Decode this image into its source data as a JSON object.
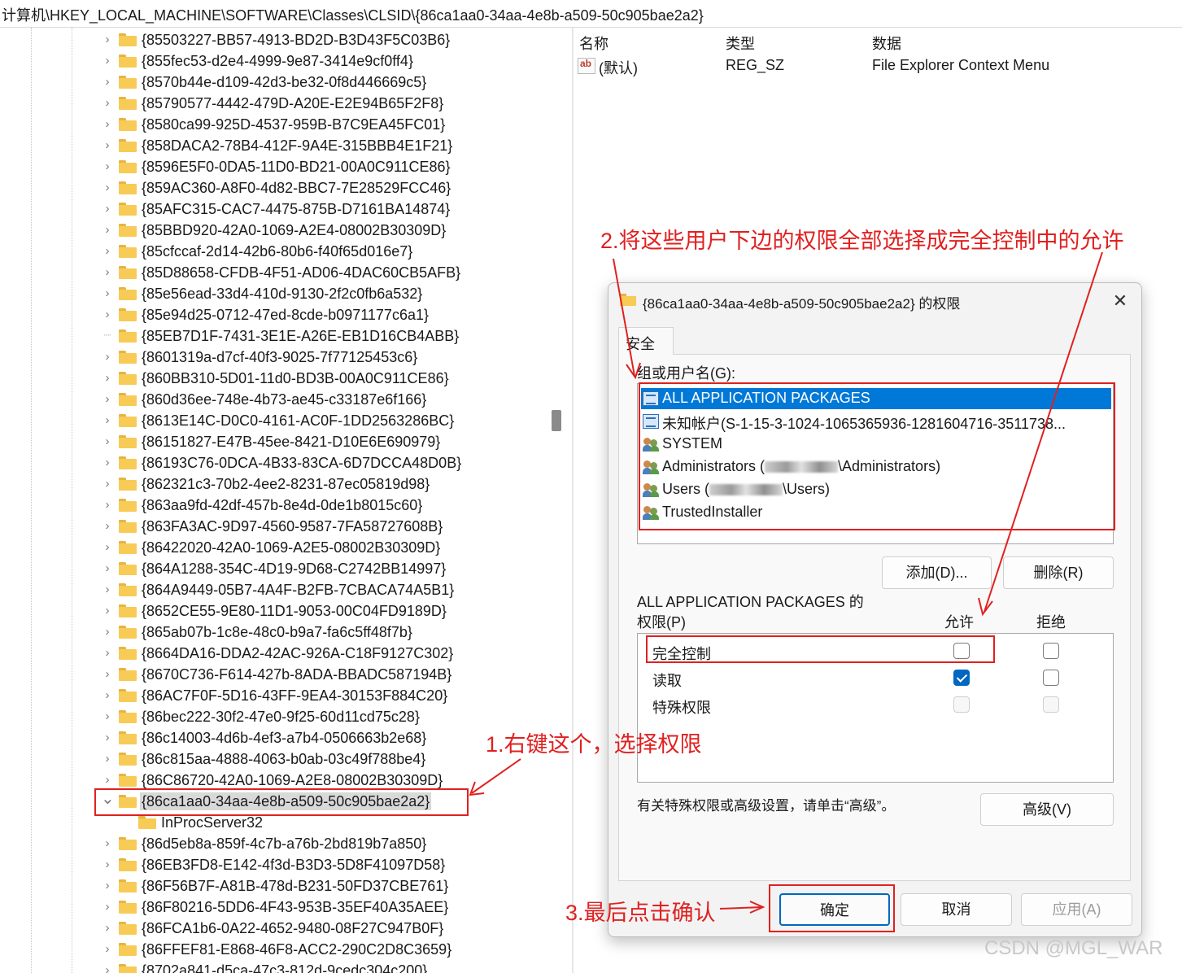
{
  "address_bar": "计算机\\HKEY_LOCAL_MACHINE\\SOFTWARE\\Classes\\CLSID\\{86ca1aa0-34aa-4e8b-a509-50c905bae2a2}",
  "tree": {
    "items": [
      "{85503227-BB57-4913-BD2D-B3D43F5C03B6}",
      "{855fec53-d2e4-4999-9e87-3414e9cf0ff4}",
      "{8570b44e-d109-42d3-be32-0f8d446669c5}",
      "{85790577-4442-479D-A20E-E2E94B65F2F8}",
      "{8580ca99-925D-4537-959B-B7C9EA45FC01}",
      "{858DACA2-78B4-412F-9A4E-315BBB4E1F21}",
      "{8596E5F0-0DA5-11D0-BD21-00A0C911CE86}",
      "{859AC360-A8F0-4d82-BBC7-7E28529FCC46}",
      "{85AFC315-CAC7-4475-875B-D7161BA14874}",
      "{85BBD920-42A0-1069-A2E4-08002B30309D}",
      "{85cfccaf-2d14-42b6-80b6-f40f65d016e7}",
      "{85D88658-CFDB-4F51-AD06-4DAC60CB5AFB}",
      "{85e56ead-33d4-410d-9130-2f2c0fb6a532}",
      "{85e94d25-0712-47ed-8cde-b0971177c6a1}",
      "{85EB7D1F-7431-3E1E-A26E-EB1D16CB4ABB}",
      "{8601319a-d7cf-40f3-9025-7f77125453c6}",
      "{860BB310-5D01-11d0-BD3B-00A0C911CE86}",
      "{860d36ee-748e-4b73-ae45-c33187e6f166}",
      "{8613E14C-D0C0-4161-AC0F-1DD2563286BC}",
      "{86151827-E47B-45ee-8421-D10E6E690979}",
      "{86193C76-0DCA-4B33-83CA-6D7DCCA48D0B}",
      "{862321c3-70b2-4ee2-8231-87ec05819d98}",
      "{863aa9fd-42df-457b-8e4d-0de1b8015c60}",
      "{863FA3AC-9D97-4560-9587-7FA58727608B}",
      "{86422020-42A0-1069-A2E5-08002B30309D}",
      "{864A1288-354C-4D19-9D68-C2742BB14997}",
      "{864A9449-05B7-4A4F-B2FB-7CBACA74A5B1}",
      "{8652CE55-9E80-11D1-9053-00C04FD9189D}",
      "{865ab07b-1c8e-48c0-b9a7-fa6c5ff48f7b}",
      "{8664DA16-DDA2-42AC-926A-C18F9127C302}",
      "{8670C736-F614-427b-8ADA-BBADC587194B}",
      "{86AC7F0F-5D16-43FF-9EA4-30153F884C20}",
      "{86bec222-30f2-47e0-9f25-60d11cd75c28}",
      "{86c14003-4d6b-4ef3-a7b4-0506663b2e68}",
      "{86c815aa-4888-4063-b0ab-03c49f788be4}",
      "{86C86720-42A0-1069-A2E8-08002B30309D}",
      "{86ca1aa0-34aa-4e8b-a509-50c905bae2a2}",
      "InProcServer32",
      "{86d5eb8a-859f-4c7b-a76b-2bd819b7a850}",
      "{86EB3FD8-E142-4f3d-B3D3-5D8F41097D58}",
      "{86F56B7F-A81B-478d-B231-50FD37CBE761}",
      "{86F80216-5DD6-4F43-953B-35EF40A35AEE}",
      "{86FCA1b6-0A22-4652-9480-08F27C947B0F}",
      "{86FFEF81-E868-46F8-ACC2-290C2D8C3659}",
      "{8702a841-d5ca-47c3-812d-9cedc304c200}"
    ]
  },
  "values": {
    "headers": {
      "name": "名称",
      "type": "类型",
      "data": "数据"
    },
    "rows": [
      {
        "name": "(默认)",
        "type": "REG_SZ",
        "data": "File Explorer Context Menu"
      }
    ]
  },
  "dialog": {
    "title": "{86ca1aa0-34aa-4e8b-a509-50c905bae2a2} 的权限",
    "tab": "安全",
    "group_label": "组或用户名(G):",
    "users": [
      {
        "pre": "ALL APPLICATION PACKAGES",
        "post": "",
        "icon": "package-icon"
      },
      {
        "pre": "未知帐户(S-1-15-3-1024-1065365936-1281604716-3511738...",
        "post": "",
        "icon": "package-icon"
      },
      {
        "pre": "SYSTEM",
        "post": "",
        "icon": "users-icon"
      },
      {
        "pre": "Administrators (",
        "post": "\\Administrators)",
        "icon": "users-icon"
      },
      {
        "pre": "Users (",
        "post": "\\Users)",
        "icon": "users-icon"
      },
      {
        "pre": "TrustedInstaller",
        "post": "",
        "icon": "users-icon"
      }
    ],
    "add_button": "添加(D)...",
    "remove_button": "删除(R)",
    "perm_for_line1": "ALL APPLICATION PACKAGES 的",
    "perm_for_line2": "权限(P)",
    "allow_header": "允许",
    "deny_header": "拒绝",
    "permissions": [
      {
        "name": "完全控制",
        "allow": "unchecked",
        "deny": "unchecked"
      },
      {
        "name": "读取",
        "allow": "checked",
        "deny": "unchecked"
      },
      {
        "name": "特殊权限",
        "allow": "disabled",
        "deny": "disabled"
      }
    ],
    "advanced_hint": "有关特殊权限或高级设置，请单击“高级”。",
    "advanced_button": "高级(V)",
    "ok_button": "确定",
    "cancel_button": "取消",
    "apply_button": "应用(A)"
  },
  "annotations": {
    "step1": "1.右键这个，选择权限",
    "step2": "2.将这些用户下边的权限全部选择成完全控制中的允许",
    "step3": "3.最后点击确认",
    "color": "#e02020"
  },
  "watermark": "CSDN @MGL_WAR"
}
